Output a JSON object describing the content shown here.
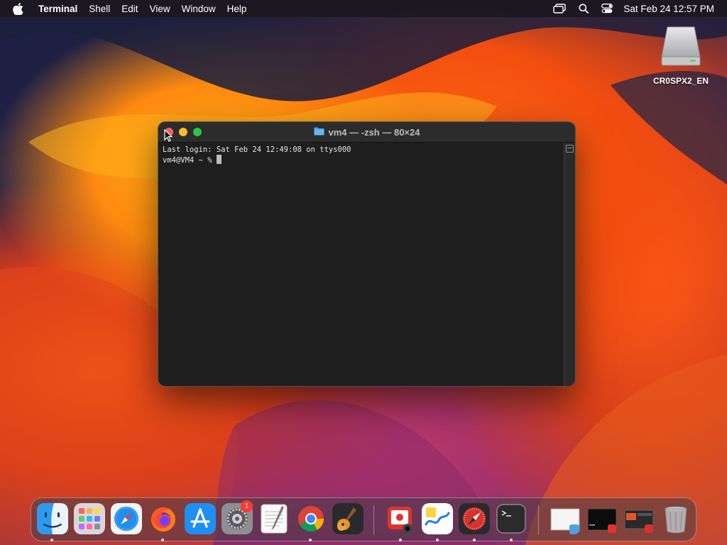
{
  "menubar": {
    "app_name": "Terminal",
    "menus": [
      "Shell",
      "Edit",
      "View",
      "Window",
      "Help"
    ],
    "clock": "Sat Feb 24  12:57 PM"
  },
  "desktop": {
    "disk_label": "CR0SPX2_EN"
  },
  "terminal": {
    "title": "vm4 — -zsh — 80×24",
    "line1": "Last login: Sat Feb 24 12:49:08 on ttys000",
    "prompt": "vm4@VM4 ~ % "
  },
  "dock": {
    "apps": [
      "Finder",
      "Launchpad",
      "Safari",
      "Firefox",
      "App Store",
      "System Settings",
      "TextEdit",
      "Google Chrome",
      "GarageBand",
      "Photo Booth",
      "Freeform",
      "Safari Technology Preview",
      "Terminal"
    ],
    "system_settings_badge": "1"
  },
  "colors": {
    "close": "#ff5f57",
    "minimize": "#febc2e",
    "zoom": "#28c840",
    "terminal_bg": "#1e1e1e"
  }
}
